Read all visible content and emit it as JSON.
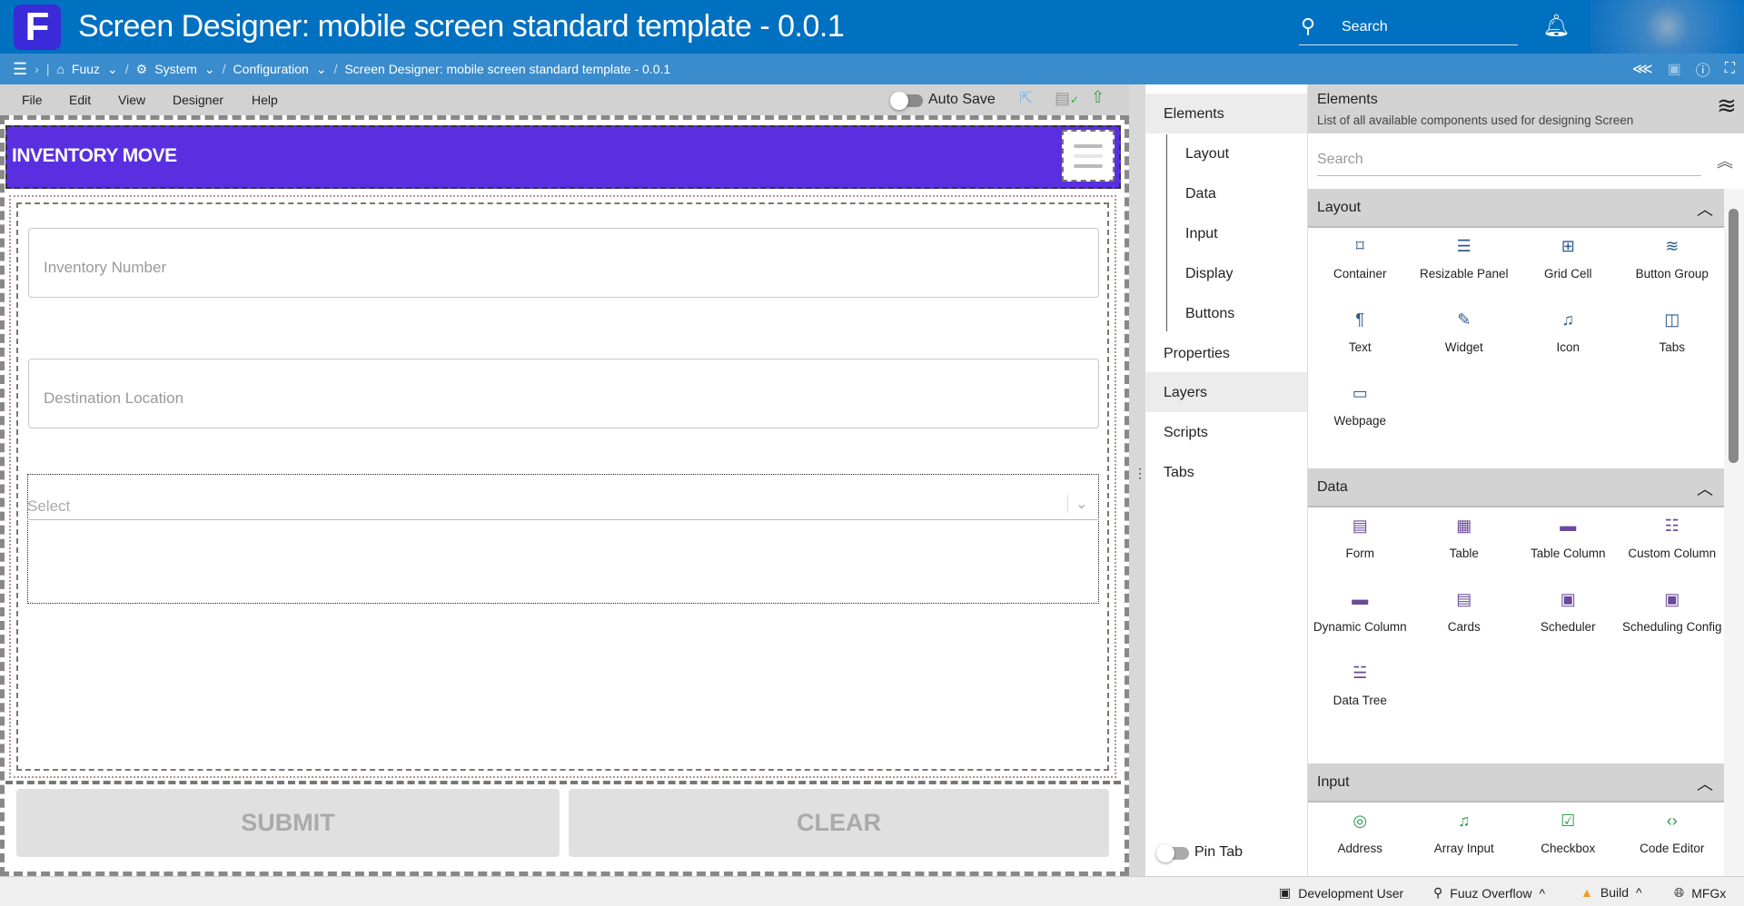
{
  "header": {
    "logo": "F",
    "title": "Screen Designer: mobile screen standard template - 0.0.1",
    "search_label": "Search"
  },
  "breadcrumb": {
    "items": [
      "Fuuz",
      "System",
      "Configuration",
      "Screen Designer: mobile screen standard template - 0.0.1"
    ]
  },
  "menubar": {
    "items": [
      "File",
      "Edit",
      "View",
      "Designer",
      "Help"
    ],
    "auto_save": "Auto Save"
  },
  "screen": {
    "title": "INVENTORY MOVE",
    "inventory_placeholder": "Inventory Number",
    "destination_placeholder": "Destination Location",
    "select_placeholder": "Select",
    "submit": "SUBMIT",
    "clear": "CLEAR"
  },
  "nav": {
    "elements": "Elements",
    "sub": [
      "Layout",
      "Data",
      "Input",
      "Display",
      "Buttons"
    ],
    "properties": "Properties",
    "layers": "Layers",
    "scripts": "Scripts",
    "tabs": "Tabs",
    "pin_tab": "Pin Tab"
  },
  "panel": {
    "title": "Elements",
    "subtitle": "List of all available components used for designing Screen",
    "search_placeholder": "Search",
    "sections": [
      {
        "name": "Layout",
        "color": "#2d5a8a",
        "items": [
          {
            "label": "Container",
            "icon": "⌑"
          },
          {
            "label": "Resizable Panel",
            "icon": "☰"
          },
          {
            "label": "Grid Cell",
            "icon": "⊞"
          },
          {
            "label": "Button Group",
            "icon": "≋"
          },
          {
            "label": "Text",
            "icon": "¶"
          },
          {
            "label": "Widget",
            "icon": "✎"
          },
          {
            "label": "Icon",
            "icon": "♫"
          },
          {
            "label": "Tabs",
            "icon": "◫"
          },
          {
            "label": "Webpage",
            "icon": "▭"
          }
        ]
      },
      {
        "name": "Data",
        "color": "#6a4a9a",
        "items": [
          {
            "label": "Form",
            "icon": "▤"
          },
          {
            "label": "Table",
            "icon": "▦"
          },
          {
            "label": "Table Column",
            "icon": "▬"
          },
          {
            "label": "Custom Column",
            "icon": "☷"
          },
          {
            "label": "Dynamic Column",
            "icon": "▬"
          },
          {
            "label": "Cards",
            "icon": "▤"
          },
          {
            "label": "Scheduler",
            "icon": "▣"
          },
          {
            "label": "Scheduling Config",
            "icon": "▣"
          },
          {
            "label": "Data Tree",
            "icon": "☱"
          }
        ]
      },
      {
        "name": "Input",
        "color": "#2e9a4a",
        "items": [
          {
            "label": "Address",
            "icon": "◎"
          },
          {
            "label": "Array Input",
            "icon": "♫"
          },
          {
            "label": "Checkbox",
            "icon": "☑"
          },
          {
            "label": "Code Editor",
            "icon": "‹›"
          }
        ]
      }
    ]
  },
  "footer": {
    "user": "Development User",
    "tenant": "Fuuz Overflow",
    "env": "Build",
    "app": "MFGx"
  }
}
